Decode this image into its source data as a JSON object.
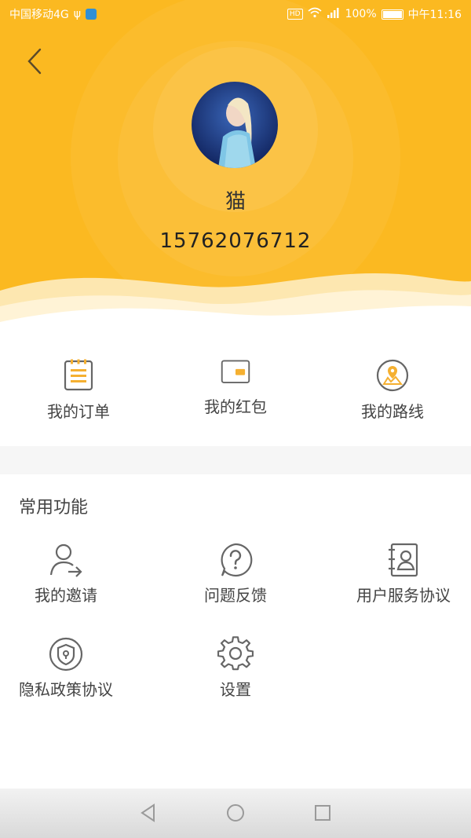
{
  "status_bar": {
    "carrier": "中国移动4G",
    "battery": "100%",
    "time": "中午11:16"
  },
  "profile": {
    "nickname": "猫",
    "phone": "15762076712"
  },
  "quick_entries": [
    {
      "label": "我的订单",
      "icon": "order-clipboard-icon"
    },
    {
      "label": "我的红包",
      "icon": "red-packet-wallet-icon"
    },
    {
      "label": "我的路线",
      "icon": "route-map-icon"
    }
  ],
  "common_functions": {
    "title": "常用功能",
    "items": [
      {
        "label": "我的邀请",
        "icon": "invite-user-icon"
      },
      {
        "label": "问题反馈",
        "icon": "feedback-question-icon"
      },
      {
        "label": "用户服务协议",
        "icon": "user-agreement-icon"
      },
      {
        "label": "隐私政策协议",
        "icon": "privacy-shield-icon"
      },
      {
        "label": "设置",
        "icon": "settings-gear-icon"
      }
    ]
  },
  "colors": {
    "accent": "#fbb921",
    "icon_stroke": "#666666",
    "icon_fill": "#f5b031"
  }
}
